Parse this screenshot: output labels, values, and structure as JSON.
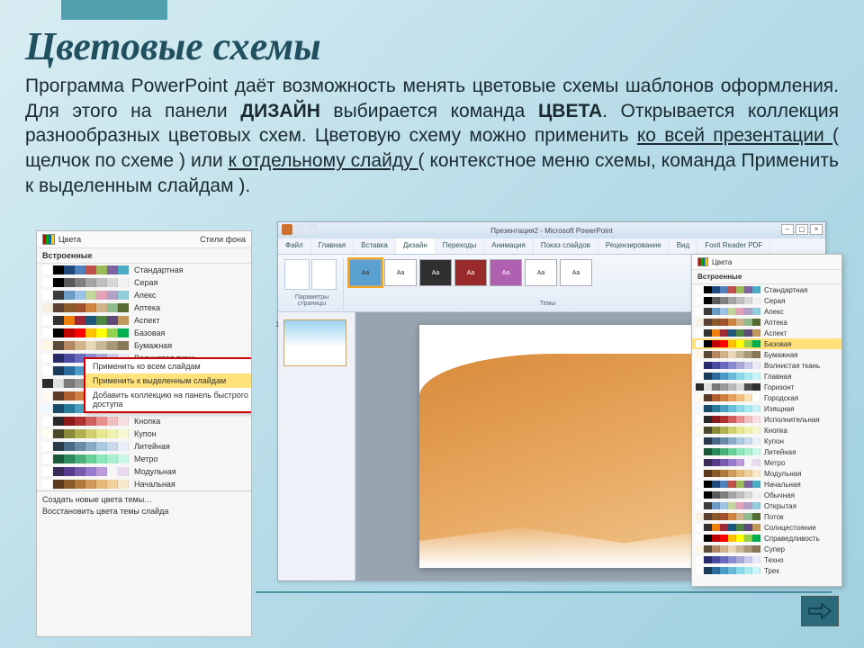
{
  "slide": {
    "title": "Цветовые схемы",
    "p1a": "Программа PowerPoint даёт возможность менять цветовые схемы шаблонов оформления. Для этого на панели ",
    "p1b": "ДИЗАЙН",
    "p1c": " выбирается команда ",
    "p1d": "ЦВЕТА",
    "p1e": ". Открывается коллекция разнообразных цветовых схем. Цветовую схему можно применить ",
    "p1f": "ко всей презентации ",
    "p1g": "( щелчок по схеме ) или ",
    "p1h": "к отдельному слайду ",
    "p1i": "( контекстное меню схемы, команда Применить к выделенным слайдам )."
  },
  "left_panel": {
    "header": "Цвета",
    "styles_label": "Стили фона",
    "section": "Встроенные",
    "schemes": [
      "Стандартная",
      "Серая",
      "Апекс",
      "Аптека",
      "Аспект",
      "Базовая",
      "Бумажная",
      "Волнистая ткань",
      "Горизонт",
      "Городская",
      "Изящная",
      "Исполнительная",
      "Кнопка",
      "Купон",
      "Литейная",
      "Метро",
      "Модульная",
      "Начальная"
    ],
    "foot1": "Создать новые цвета темы…",
    "foot2": "Восстановить цвета темы слайда"
  },
  "context_menu": {
    "item1": "Применить ко всем слайдам",
    "item2": "Применить к выделенным слайдам",
    "item3": "Добавить коллекцию на панель быстрого доступа"
  },
  "pp": {
    "title": "Презентация2 - Microsoft PowerPoint",
    "tabs": [
      "Файл",
      "Главная",
      "Вставка",
      "Дизайн",
      "Переходы",
      "Анимация",
      "Показ слайдов",
      "Рецензирование",
      "Вид",
      "Foxit Reader PDF"
    ],
    "active_tab": "Дизайн",
    "group_page": "Параметры страницы",
    "group_themes": "Темы",
    "btn_colors": "Цвета",
    "btn_fonts": "Стили фона",
    "theme_label": "Aa"
  },
  "right_panel": {
    "header": "Цвета",
    "section": "Встроенные",
    "schemes": [
      "Стандартная",
      "Серая",
      "Апекс",
      "Аптека",
      "Аспект",
      "Базовая",
      "Бумажная",
      "Волнистая ткань",
      "Главная",
      "Горизонт",
      "Городская",
      "Изящная",
      "Исполнительная",
      "Кнопка",
      "Купон",
      "Литейная",
      "Метро",
      "Модульная",
      "Начальная",
      "Обычная",
      "Открытая",
      "Поток",
      "Солнцестояние",
      "Справедливость",
      "Супер",
      "Техно",
      "Трек"
    ],
    "highlight_index": 5
  },
  "nav": {
    "label": "next"
  },
  "scheme_palettes": [
    [
      "#ffffff",
      "#000000",
      "#1f497d",
      "#4f81bd",
      "#c0504d",
      "#9bbb59",
      "#8064a2",
      "#4bacc6"
    ],
    [
      "#ffffff",
      "#000000",
      "#595959",
      "#7f7f7f",
      "#a5a5a5",
      "#bfbfbf",
      "#d8d8d8",
      "#f2f2f2"
    ],
    [
      "#ffffff",
      "#3b3b3b",
      "#6b9bc7",
      "#9cc3e5",
      "#c3d69b",
      "#e2a2b8",
      "#b2a1c7",
      "#92cddc"
    ],
    [
      "#f5f0e1",
      "#5c4033",
      "#8b5a2b",
      "#a0522d",
      "#cd853f",
      "#d2b48c",
      "#8fbc8f",
      "#556b2f"
    ],
    [
      "#ffffff",
      "#323232",
      "#f07f09",
      "#9f2936",
      "#1b587c",
      "#4e8542",
      "#604878",
      "#c19859"
    ],
    [
      "#ffffff",
      "#000000",
      "#c00000",
      "#ff0000",
      "#ffc000",
      "#ffff00",
      "#92d050",
      "#00b050"
    ],
    [
      "#fdf6e3",
      "#5a4a3a",
      "#b58863",
      "#d2b48c",
      "#e8d8b8",
      "#c8b898",
      "#a89878",
      "#887858"
    ],
    [
      "#ffffff",
      "#2a2a6a",
      "#4a4aa0",
      "#6a6ac0",
      "#8a8ad0",
      "#aaaad8",
      "#cacaea",
      "#eaeaf8"
    ],
    [
      "#ffffff",
      "#1a3a5a",
      "#2a6a9a",
      "#4a9aca",
      "#6abada",
      "#8adaea",
      "#aaeaf0",
      "#caf5fa"
    ],
    [
      "#2b2b2b",
      "#e0e0e0",
      "#7a7a7a",
      "#9a9a9a",
      "#bababa",
      "#dadada",
      "#505050",
      "#303030"
    ],
    [
      "#fff8f0",
      "#5a3a2a",
      "#b06030",
      "#d08040",
      "#e8a060",
      "#f0c080",
      "#f8e0b0",
      "#ffffff"
    ],
    [
      "#f0f8ff",
      "#1a4a6a",
      "#2a7a9a",
      "#4aa0c0",
      "#6ac0d8",
      "#8ad8e8",
      "#aae8f0",
      "#caf0f8"
    ],
    [
      "#ffffff",
      "#2a2a2a",
      "#8a1a1a",
      "#b03030",
      "#d06060",
      "#e89090",
      "#f0c0c0",
      "#f8e0e0"
    ],
    [
      "#fffdf0",
      "#4a4a2a",
      "#8a8a3a",
      "#b0b050",
      "#d0d070",
      "#e8e890",
      "#f0f0b0",
      "#f8f8d0"
    ],
    [
      "#ffffff",
      "#2a3a4a",
      "#4a6a8a",
      "#6a8aaa",
      "#8aaaca",
      "#aacae0",
      "#cadaea",
      "#eaf0f8"
    ],
    [
      "#ffffff",
      "#1a5a3a",
      "#2a8a5a",
      "#4ab07a",
      "#6ad09a",
      "#8ae8ba",
      "#aaf0d0",
      "#caf8e8"
    ],
    [
      "#ffffff",
      "#3a2a5a",
      "#5a3a8a",
      "#7a5aaa",
      "#9a7aca",
      "#ba9ad8",
      "#daboe8",
      "#eadaf0"
    ],
    [
      "#ffffff",
      "#5a3a1a",
      "#8a5a2a",
      "#b07a3a",
      "#d09a5a",
      "#e8ba7a",
      "#f0d09a",
      "#f8e8ca"
    ]
  ]
}
